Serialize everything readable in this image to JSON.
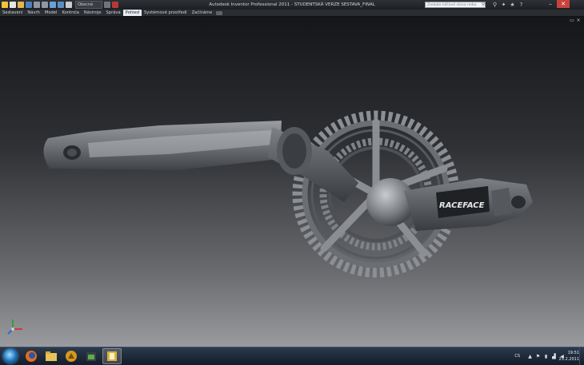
{
  "window": {
    "title": "Autodesk Inventor Professional 2011 - STUDENTSKÁ VERZE   SESTAVA_FINAL",
    "project_combo": "Obecné"
  },
  "search": {
    "placeholder": "Zadejte klíčové slovo nebo výraz"
  },
  "ribbon": {
    "tabs": [
      {
        "label": "Sestavení",
        "active": false
      },
      {
        "label": "Návrh",
        "active": false
      },
      {
        "label": "Model",
        "active": false
      },
      {
        "label": "Kontrola",
        "active": false
      },
      {
        "label": "Nástroje",
        "active": false
      },
      {
        "label": "Správa",
        "active": false
      },
      {
        "label": "Pohled",
        "active": true
      },
      {
        "label": "Systémové prostředí",
        "active": false
      },
      {
        "label": "Začínáme",
        "active": false
      }
    ]
  },
  "viewport": {
    "model_logo_text": "RACEFACE"
  },
  "taskbar": {
    "language": "CS",
    "time": "19:51",
    "date": "25.2.2011"
  },
  "icons": {
    "qat": [
      "inventor-logo-icon",
      "new-icon",
      "open-icon",
      "save-icon",
      "undo-icon",
      "redo-icon",
      "home-icon",
      "return-icon",
      "update-icon",
      "select-icon",
      "appearance-icon"
    ],
    "apps": [
      "firefox-icon",
      "explorer-icon",
      "app-icon",
      "app-green-icon",
      "inventor-icon"
    ]
  },
  "colors": {
    "title_bg": "#1d1f23",
    "active_tab": "#e9edf2",
    "close_button": "#c8433c",
    "taskbar": "#151d29"
  }
}
